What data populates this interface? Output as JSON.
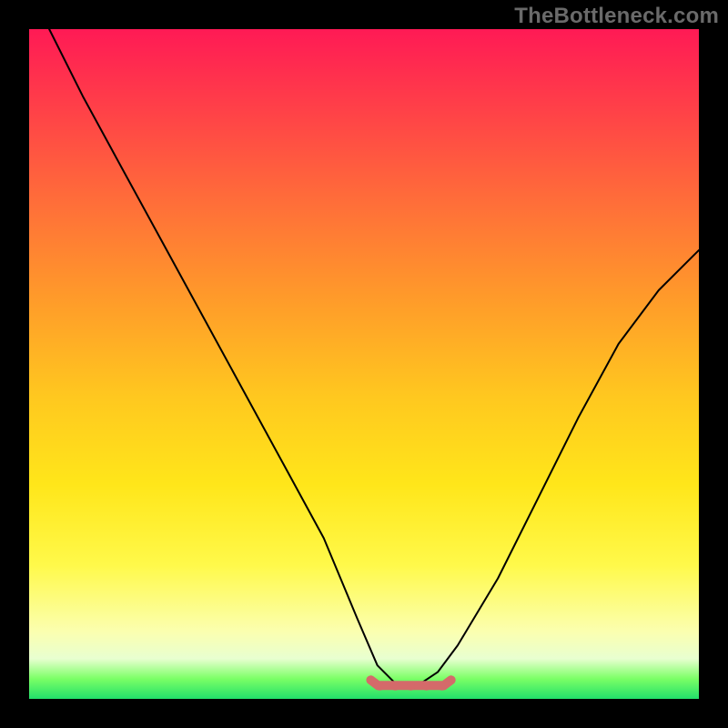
{
  "watermark": "TheBottleneck.com",
  "chart_data": {
    "type": "line",
    "title": "",
    "xlabel": "",
    "ylabel": "",
    "xlim": [
      0,
      100
    ],
    "ylim": [
      0,
      100
    ],
    "grid": false,
    "legend": false,
    "series": [
      {
        "name": "bottleneck-curve",
        "x": [
          3,
          8,
          14,
          20,
          26,
          32,
          38,
          44,
          49,
          52,
          55,
          58,
          61,
          64,
          70,
          76,
          82,
          88,
          94,
          100
        ],
        "y": [
          100,
          90,
          79,
          68,
          57,
          46,
          35,
          24,
          12,
          5,
          2,
          2,
          4,
          8,
          18,
          30,
          42,
          53,
          61,
          67
        ]
      }
    ],
    "annotations": [
      {
        "type": "trough-band",
        "x_start": 51,
        "x_end": 63,
        "y": 2
      }
    ],
    "background_gradient_note": "vertical rainbow red→green indicating bottleneck severity"
  }
}
